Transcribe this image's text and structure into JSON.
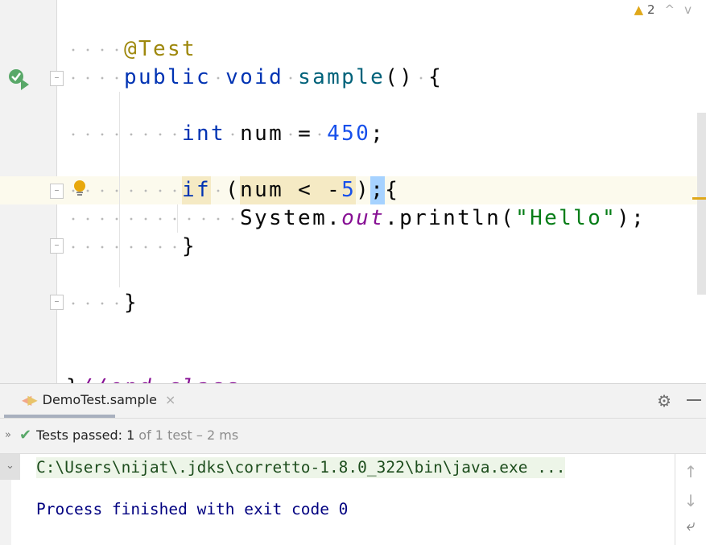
{
  "editor": {
    "inspection": {
      "warning_count": "2",
      "up": "^",
      "down": "v"
    },
    "lines": [
      {
        "row": 0,
        "tokens": [
          [
            "ws",
            "    "
          ],
          [
            "ann",
            "@Test"
          ]
        ]
      },
      {
        "row": 1,
        "tokens": [
          [
            "ws",
            "    "
          ],
          [
            "kw",
            "public"
          ],
          [
            "ws",
            " "
          ],
          [
            "kw",
            "void"
          ],
          [
            "ws",
            " "
          ],
          [
            "fn",
            "sample"
          ],
          [
            "",
            "()"
          ],
          [
            "ws",
            " "
          ],
          [
            "",
            "{"
          ]
        ]
      },
      {
        "row": 3,
        "tokens": [
          [
            "ws",
            "        "
          ],
          [
            "kw",
            "int"
          ],
          [
            "ws",
            " "
          ],
          [
            "",
            "num"
          ],
          [
            "ws",
            " "
          ],
          [
            "",
            "="
          ],
          [
            "ws",
            " "
          ],
          [
            "num",
            "450"
          ],
          [
            "",
            ";"
          ]
        ]
      },
      {
        "row": 5,
        "tokens": [
          [
            "ws",
            "        "
          ],
          [
            "kw tan",
            "if"
          ],
          [
            "ws",
            " "
          ],
          [
            "",
            "("
          ],
          [
            "tan",
            "num"
          ],
          [
            "ws tan",
            " "
          ],
          [
            "tan",
            "<"
          ],
          [
            "ws tan",
            " "
          ],
          [
            "tan",
            "-"
          ],
          [
            "num tan",
            "5"
          ],
          [
            "",
            ")"
          ],
          [
            "sel",
            ";"
          ],
          [
            "",
            "{"
          ]
        ]
      },
      {
        "row": 6,
        "tokens": [
          [
            "ws",
            "            "
          ],
          [
            "",
            "System."
          ],
          [
            "fld",
            "out"
          ],
          [
            "",
            ".println("
          ],
          [
            "str",
            "\"Hello\""
          ],
          [
            "",
            ");"
          ]
        ]
      },
      {
        "row": 7,
        "tokens": [
          [
            "ws",
            "        "
          ],
          [
            "",
            "}"
          ]
        ]
      },
      {
        "row": 9,
        "tokens": [
          [
            "ws",
            "    "
          ],
          [
            "",
            "}"
          ]
        ]
      },
      {
        "row": 12,
        "tokens": [
          [
            "",
            "}"
          ],
          [
            "fld",
            "//end class"
          ]
        ]
      }
    ]
  },
  "panel": {
    "tab_label": "DemoTest.sample",
    "tab_close": "×",
    "status_prefix": "Tests passed: ",
    "status_count": "1",
    "status_rest": "of 1 test – 2 ms",
    "expand": "»",
    "console": {
      "command": "C:\\Users\\nijat\\.jdks\\corretto-1.8.0_322\\bin\\java.exe ...",
      "exit": "Process finished with exit code 0"
    }
  },
  "colors": {
    "accent_warning": "#e0a81a",
    "success": "#59a869"
  }
}
